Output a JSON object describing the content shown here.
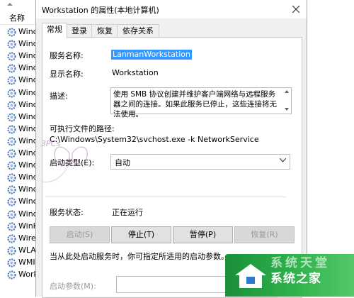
{
  "background_list": {
    "header": "名称",
    "rows": [
      "Wind",
      "Wind",
      "Wind",
      "Wind",
      "Wind",
      "Wind",
      "Wind",
      "Wind",
      "Wind",
      "Wind",
      "Wind",
      "Wind",
      "Wind",
      "Wind",
      "Wind",
      "Wind",
      "WinH",
      "Wire",
      "WLAI",
      "WMI",
      "Work"
    ]
  },
  "dialog": {
    "title": "Workstation 的属性(本地计算机)",
    "tabs": [
      {
        "label": "常规",
        "active": true
      },
      {
        "label": "登录",
        "active": false
      },
      {
        "label": "恢复",
        "active": false
      },
      {
        "label": "依存关系",
        "active": false
      }
    ],
    "service_name_label": "服务名称:",
    "service_name_value": "LanmanWorkstation",
    "display_name_label": "显示名称:",
    "display_name_value": "Workstation",
    "description_label": "描述:",
    "description_value": "使用 SMB 协议创建并维护客户端网络与远程服务器之间的连接。如果此服务已停止，这些连接将无法使用。",
    "exe_path_label": "可执行文件的路径:",
    "exe_path_value": "C:\\Windows\\System32\\svchost.exe -k NetworkService",
    "startup_type_label": "启动类型(E):",
    "startup_type_value": "自动",
    "status_label": "服务状态:",
    "status_value": "正在运行",
    "buttons": {
      "start": "启动(S)",
      "stop": "停止(T)",
      "pause": "暂停(P)",
      "resume": "恢复(R)"
    },
    "hint": "当从此处启动服务时，你可指定所适用的启动参数。",
    "params_label": "启动参数(M):"
  },
  "watermark": "3PCs",
  "brand": {
    "name": "系统之家",
    "ghost_text": "系统天堂"
  },
  "colors": {
    "selection": "#3399ff",
    "brand_green": "#2fb34c",
    "gear_blue": "#4a78c2"
  }
}
